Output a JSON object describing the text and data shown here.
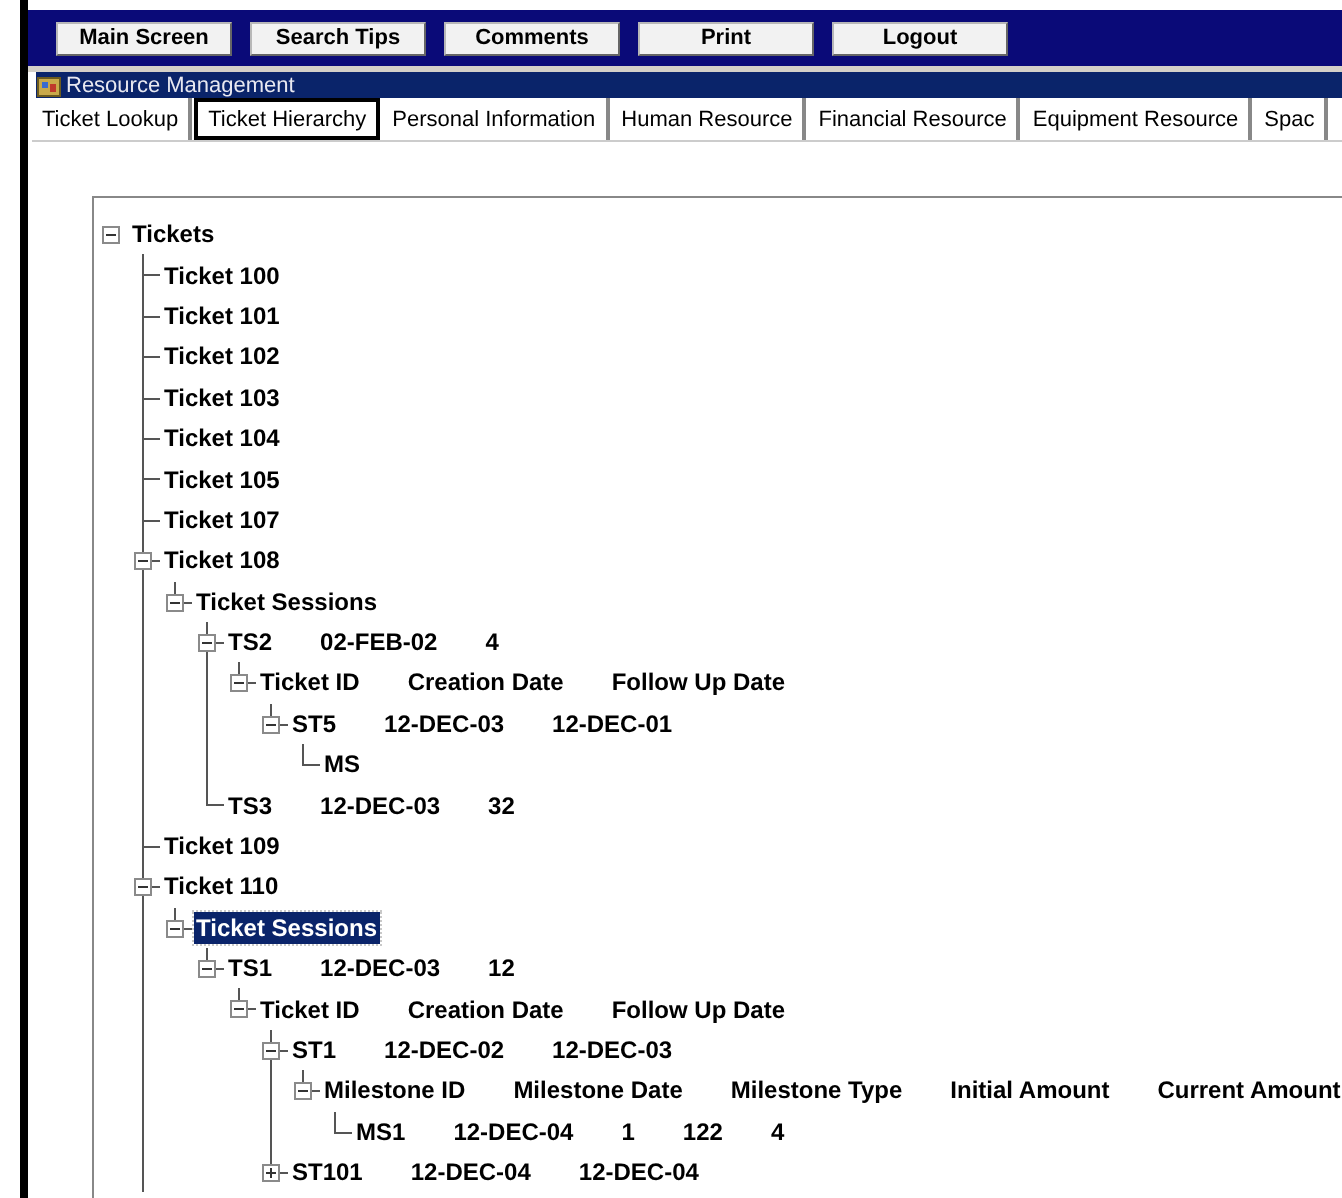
{
  "nav_buttons": [
    "Main Screen",
    "Search Tips",
    "Comments",
    "Print",
    "Logout"
  ],
  "panel": {
    "title": "Resource Management"
  },
  "tabs": [
    {
      "label": "Ticket Lookup",
      "selected": false
    },
    {
      "label": "Ticket Hierarchy",
      "selected": true
    },
    {
      "label": "Personal Information",
      "selected": false
    },
    {
      "label": "Human Resource",
      "selected": false
    },
    {
      "label": "Financial Resource",
      "selected": false
    },
    {
      "label": "Equipment Resource",
      "selected": false
    },
    {
      "label": "Spac",
      "selected": false
    }
  ],
  "tree": {
    "cells": [
      "Tickets"
    ],
    "expanded": true,
    "selected": false,
    "children": [
      {
        "cells": [
          "Ticket 100"
        ],
        "selected": false
      },
      {
        "cells": [
          "Ticket 101"
        ],
        "selected": false
      },
      {
        "cells": [
          "Ticket 102"
        ],
        "selected": false
      },
      {
        "cells": [
          "Ticket 103"
        ],
        "selected": false
      },
      {
        "cells": [
          "Ticket 104"
        ],
        "selected": false
      },
      {
        "cells": [
          "Ticket 105"
        ],
        "selected": false
      },
      {
        "cells": [
          "Ticket 107"
        ],
        "selected": false
      },
      {
        "cells": [
          "Ticket 108"
        ],
        "expanded": true,
        "selected": false,
        "children": [
          {
            "cells": [
              "Ticket Sessions"
            ],
            "expanded": true,
            "selected": false,
            "children": [
              {
                "cells": [
                  "TS2",
                  "02-FEB-02",
                  "4"
                ],
                "expanded": true,
                "selected": false,
                "children": [
                  {
                    "cells": [
                      "Ticket ID",
                      "Creation Date",
                      "Follow Up Date"
                    ],
                    "expanded": true,
                    "selected": false,
                    "children": [
                      {
                        "cells": [
                          "ST5",
                          "12-DEC-03",
                          "12-DEC-01"
                        ],
                        "expanded": true,
                        "selected": false,
                        "children": [
                          {
                            "cells": [
                              "MS"
                            ],
                            "selected": false
                          }
                        ]
                      }
                    ]
                  }
                ]
              },
              {
                "cells": [
                  "TS3",
                  "12-DEC-03",
                  "32"
                ],
                "selected": false
              }
            ]
          }
        ]
      },
      {
        "cells": [
          "Ticket 109"
        ],
        "selected": false
      },
      {
        "cells": [
          "Ticket 110"
        ],
        "expanded": true,
        "selected": false,
        "children": [
          {
            "cells": [
              "Ticket Sessions"
            ],
            "expanded": true,
            "selected": true,
            "children": [
              {
                "cells": [
                  "TS1",
                  "12-DEC-03",
                  "12"
                ],
                "expanded": true,
                "selected": false,
                "children": [
                  {
                    "cells": [
                      "Ticket ID",
                      "Creation Date",
                      "Follow Up Date"
                    ],
                    "expanded": true,
                    "selected": false,
                    "children": [
                      {
                        "cells": [
                          "ST1",
                          "12-DEC-02",
                          "12-DEC-03"
                        ],
                        "expanded": true,
                        "selected": false,
                        "children": [
                          {
                            "cells": [
                              "Milestone ID",
                              "Milestone Date",
                              "Milestone Type",
                              "Initial Amount",
                              "Current Amount"
                            ],
                            "expanded": true,
                            "selected": false,
                            "children": [
                              {
                                "cells": [
                                  "MS1",
                                  "12-DEC-04",
                                  "1",
                                  "122",
                                  "4"
                                ],
                                "selected": false
                              }
                            ]
                          }
                        ]
                      },
                      {
                        "cells": [
                          "ST101",
                          "12-DEC-04",
                          "12-DEC-04"
                        ],
                        "expanded": false,
                        "selected": false
                      }
                    ]
                  }
                ]
              }
            ]
          }
        ]
      }
    ]
  }
}
